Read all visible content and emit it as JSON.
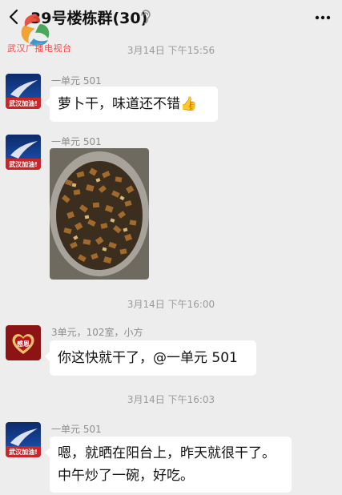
{
  "header": {
    "title": "39号楼栋群(30)",
    "back_icon": "chevron-left-icon",
    "mute_icon": "ear-icon",
    "more_icon": "more-icon"
  },
  "watermark": {
    "text": "武汉广播电视台"
  },
  "timestamps": [
    "3月14日 下午15:56",
    "3月14日 下午16:00",
    "3月14日 下午16:03"
  ],
  "messages": [
    {
      "sender": "一单元 501",
      "text": "萝卜干，味道还不错",
      "emoji": "👍"
    },
    {
      "sender": "一单元 501",
      "image": "photo-radish-bowl"
    },
    {
      "sender": "3单元，102室，小方",
      "text": "你这快就干了，@一单元 501"
    },
    {
      "sender": "一单元 501",
      "lines": [
        "嗯，就晒在阳台上，昨天就很干了。",
        "中午炒了一碗，好吃。"
      ]
    }
  ],
  "avatars": {
    "wuhan": {
      "label": "武汉加油!"
    },
    "ganen": {
      "label": "感恩"
    }
  },
  "colors": {
    "background": "#ededed",
    "bubble": "#ffffff",
    "timestamp": "#9a9a9a"
  }
}
